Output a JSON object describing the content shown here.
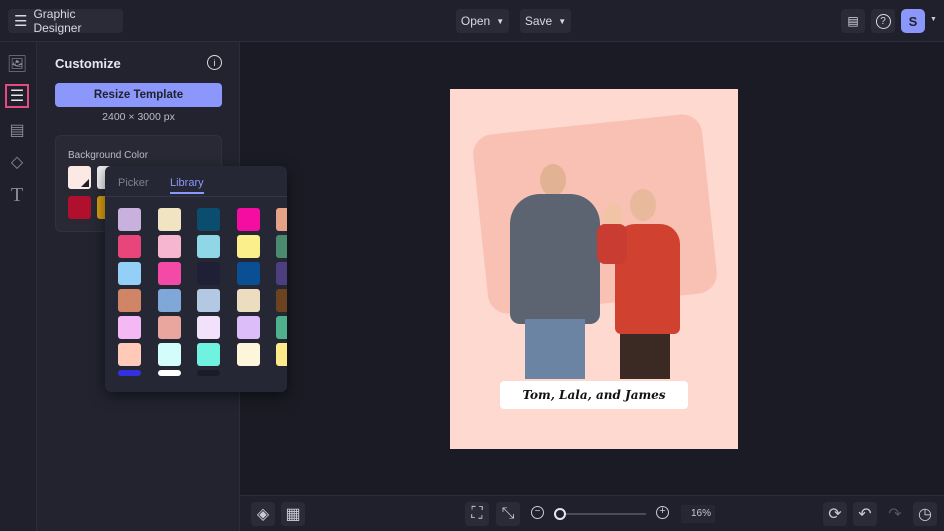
{
  "header": {
    "app_title": "Graphic Designer",
    "open_label": "Open",
    "save_label": "Save",
    "avatar_initial": "S"
  },
  "panel": {
    "title": "Customize",
    "resize_label": "Resize Template",
    "dimensions": "2400 × 3000 px",
    "bg_color_label": "Background Color"
  },
  "palette": {
    "tabs": [
      "Picker",
      "Library"
    ],
    "active_tab": "Library",
    "selected": "#fde9e4",
    "colors": [
      [
        "#c9b1dd",
        "#f1e4c2",
        "#0a4d6e",
        "#f50ca0",
        "#e6a287",
        "#f8d3e2"
      ],
      [
        "#e8457a",
        "#f7b6d0",
        "#8fd6e6",
        "#fbef8c",
        "#4a8a6e",
        "#ff0000"
      ],
      [
        "#94cff7",
        "#f24aa6",
        "#1f1f35",
        "#0a4f93",
        "#4c3f80",
        "#a3dde0"
      ],
      [
        "#d08566",
        "#7fa8d9",
        "#b2c8e3",
        "#ecdcc0",
        "#6b4321",
        "#1433c0"
      ],
      [
        "#f4b8f5",
        "#e8a69e",
        "#f1e1fb",
        "#dcbcf9",
        "#4fb08d",
        "#fde9e4"
      ],
      [
        "#ffcbb8",
        "#d2fdfb",
        "#6ff2e0",
        "#fdf6da",
        "#fdeb8a",
        "#f2d624"
      ],
      [
        "#3430e0",
        "#ffffff",
        "#1b1b2c"
      ]
    ]
  },
  "canvas": {
    "caption": "Tom, Lala, and James",
    "background": "#fdd9d0"
  },
  "footer": {
    "zoom": "16%",
    "zoom_value": 16
  }
}
